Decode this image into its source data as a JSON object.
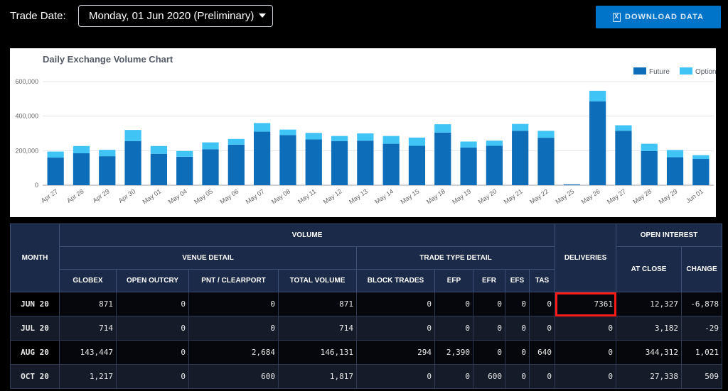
{
  "topbar": {
    "trade_date_label": "Trade Date:",
    "date_value": "Monday, 01 Jun 2020 (Preliminary)",
    "download_label": "DOWNLOAD DATA"
  },
  "chart_data": {
    "type": "bar",
    "stacked": true,
    "title": "Daily Exchange Volume Chart",
    "categories": [
      "Apr 27",
      "Apr 28",
      "Apr 29",
      "Apr 30",
      "May 01",
      "May 04",
      "May 05",
      "May 06",
      "May 07",
      "May 08",
      "May 11",
      "May 12",
      "May 13",
      "May 14",
      "May 15",
      "May 18",
      "May 19",
      "May 20",
      "May 21",
      "May 22",
      "May 25",
      "May 26",
      "May 27",
      "May 28",
      "May 29",
      "Jun 01"
    ],
    "series": [
      {
        "name": "Future",
        "color": "#0d6db8",
        "values": [
          160000,
          185000,
          168000,
          255000,
          182000,
          165000,
          208000,
          235000,
          310000,
          290000,
          265000,
          255000,
          258000,
          240000,
          228000,
          305000,
          218000,
          228000,
          315000,
          275000,
          5000,
          485000,
          315000,
          198000,
          162000,
          152000
        ]
      },
      {
        "name": "Option",
        "color": "#40c3f5",
        "values": [
          35000,
          42000,
          37000,
          65000,
          45000,
          33000,
          40000,
          33000,
          50000,
          32000,
          38000,
          30000,
          42000,
          45000,
          48000,
          48000,
          35000,
          30000,
          40000,
          40000,
          0,
          62000,
          32000,
          42000,
          42000,
          22000
        ]
      }
    ],
    "y_ticks": [
      "0",
      "200,000",
      "400,000",
      "600,000"
    ],
    "ylim": [
      0,
      600000
    ],
    "legend_position": "top-right",
    "grid": true
  },
  "table": {
    "headers": {
      "month": "MONTH",
      "volume": "VOLUME",
      "venue_detail": "VENUE DETAIL",
      "trade_type_detail": "TRADE TYPE DETAIL",
      "deliveries": "DELIVERIES",
      "open_interest": "OPEN INTEREST",
      "globex": "GLOBEX",
      "open_outcry": "OPEN OUTCRY",
      "pnt_clearport": "PNT / CLEARPORT",
      "total_volume": "TOTAL VOLUME",
      "block_trades": "BLOCK TRADES",
      "efp": "EFP",
      "efr": "EFR",
      "efs": "EFS",
      "tas": "TAS",
      "at_close": "AT CLOSE",
      "change": "CHANGE"
    },
    "rows": [
      {
        "month": "JUN 20",
        "globex": "871",
        "open_outcry": "0",
        "pnt": "0",
        "total": "871",
        "block": "0",
        "efp": "0",
        "efr": "0",
        "efs": "0",
        "tas": "0",
        "deliveries": "7361",
        "at_close": "12,327",
        "change": "-6,878"
      },
      {
        "month": "JUL 20",
        "globex": "714",
        "open_outcry": "0",
        "pnt": "0",
        "total": "714",
        "block": "0",
        "efp": "0",
        "efr": "0",
        "efs": "0",
        "tas": "0",
        "deliveries": "0",
        "at_close": "3,182",
        "change": "-29"
      },
      {
        "month": "AUG 20",
        "globex": "143,447",
        "open_outcry": "0",
        "pnt": "2,684",
        "total": "146,131",
        "block": "294",
        "efp": "2,390",
        "efr": "0",
        "efs": "0",
        "tas": "640",
        "deliveries": "0",
        "at_close": "344,312",
        "change": "1,021"
      },
      {
        "month": "OCT 20",
        "globex": "1,217",
        "open_outcry": "0",
        "pnt": "600",
        "total": "1,817",
        "block": "0",
        "efp": "0",
        "efr": "600",
        "efs": "0",
        "tas": "0",
        "deliveries": "0",
        "at_close": "27,338",
        "change": "509"
      }
    ]
  }
}
